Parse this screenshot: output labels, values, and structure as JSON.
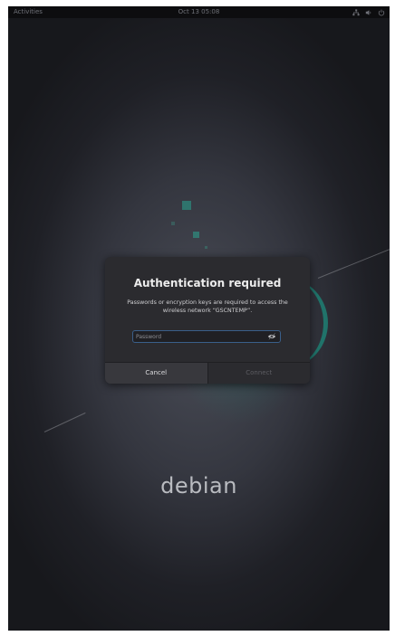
{
  "topbar": {
    "activities": "Activities",
    "clock": "Oct 13  05:08",
    "tray_icons": [
      "network-icon",
      "volume-icon",
      "power-icon"
    ]
  },
  "dialog": {
    "title": "Authentication required",
    "message": "Passwords or encryption keys are required to access the wireless network “GSCNTEMP”.",
    "password_placeholder": "Password",
    "password_value": "",
    "cancel_label": "Cancel",
    "connect_label": "Connect"
  },
  "wallpaper": {
    "logo_text": "debian",
    "accent_color": "#2e7f74"
  }
}
